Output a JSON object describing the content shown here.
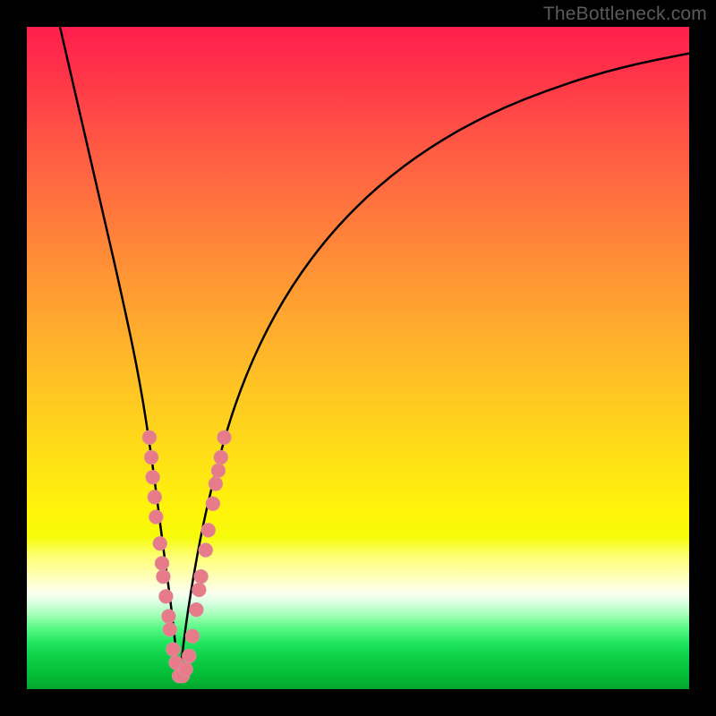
{
  "watermark": "TheBottleneck.com",
  "chart_data": {
    "type": "line",
    "title": "",
    "xlabel": "",
    "ylabel": "",
    "xlim": [
      0,
      100
    ],
    "ylim": [
      0,
      100
    ],
    "grid": false,
    "legend": false,
    "background_gradient": {
      "top_color": "#ff1f4d",
      "mid_color": "#ffd81a",
      "bottom_color": "#03a42b"
    },
    "curve": {
      "description": "V-shaped bottleneck curve with sharp minimum near x≈23",
      "x": [
        5,
        8,
        11,
        14,
        17,
        19,
        20.5,
        22,
        23,
        24,
        26,
        28,
        31,
        35,
        40,
        46,
        53,
        61,
        70,
        80,
        90,
        100
      ],
      "y": [
        100,
        87,
        74,
        61,
        47,
        34,
        22,
        11,
        1,
        10,
        22,
        31,
        42,
        52,
        61,
        69,
        76,
        82,
        87,
        91,
        94,
        96
      ]
    },
    "scatter_points": {
      "description": "Observed data points clustered around the curve minimum",
      "color": "#e77b8a",
      "points": [
        {
          "x": 18.5,
          "y": 38
        },
        {
          "x": 18.8,
          "y": 35
        },
        {
          "x": 19.0,
          "y": 32
        },
        {
          "x": 19.3,
          "y": 29
        },
        {
          "x": 19.5,
          "y": 26
        },
        {
          "x": 20.1,
          "y": 22
        },
        {
          "x": 20.4,
          "y": 19
        },
        {
          "x": 20.6,
          "y": 17
        },
        {
          "x": 21.0,
          "y": 14
        },
        {
          "x": 21.4,
          "y": 11
        },
        {
          "x": 21.6,
          "y": 9
        },
        {
          "x": 22.1,
          "y": 6
        },
        {
          "x": 22.5,
          "y": 4
        },
        {
          "x": 23.0,
          "y": 2
        },
        {
          "x": 23.5,
          "y": 2
        },
        {
          "x": 24.0,
          "y": 3
        },
        {
          "x": 24.5,
          "y": 5
        },
        {
          "x": 25.0,
          "y": 8
        },
        {
          "x": 25.6,
          "y": 12
        },
        {
          "x": 26.0,
          "y": 15
        },
        {
          "x": 26.3,
          "y": 17
        },
        {
          "x": 27.0,
          "y": 21
        },
        {
          "x": 27.4,
          "y": 24
        },
        {
          "x": 28.1,
          "y": 28
        },
        {
          "x": 28.5,
          "y": 31
        },
        {
          "x": 28.9,
          "y": 33
        },
        {
          "x": 29.3,
          "y": 35
        },
        {
          "x": 29.8,
          "y": 38
        }
      ]
    }
  }
}
